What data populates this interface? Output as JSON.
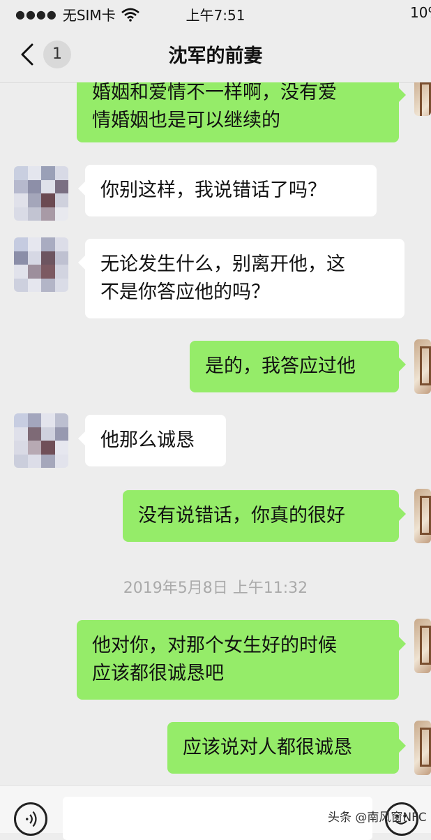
{
  "status_bar": {
    "carrier": "无SIM卡",
    "time": "上午7:51",
    "battery": "10%"
  },
  "nav": {
    "unread_count": "1",
    "title": "沈军的前妻"
  },
  "messages": [
    {
      "dir": "out",
      "lines": [
        "婚姻和爱情不一样啊，没有爱",
        "情婚姻也是可以继续的"
      ]
    },
    {
      "dir": "in",
      "lines": [
        "你别这样，我说错话了吗？"
      ]
    },
    {
      "dir": "in",
      "lines": [
        "无论发生什么，别离开他，这",
        "不是你答应他的吗？"
      ]
    },
    {
      "dir": "out",
      "lines": [
        "是的，我答应过他"
      ]
    },
    {
      "dir": "in",
      "lines": [
        "他那么诚恳"
      ]
    },
    {
      "dir": "out",
      "lines": [
        "没有说错话，你真的很好"
      ]
    },
    {
      "dir": "out",
      "lines": [
        "他对你，对那个女生好的时候",
        "应该都很诚恳吧"
      ]
    },
    {
      "dir": "out",
      "lines": [
        "应该说对人都很诚恳"
      ]
    }
  ],
  "timestamp": "2019年5月8日 上午11:32",
  "input": {
    "placeholder": ""
  },
  "watermark": "头条 @南风窗NFC",
  "colors": {
    "outgoing_bubble": "#95ec69",
    "incoming_bubble": "#ffffff",
    "background": "#ededed"
  },
  "icons": [
    "back-chevron-icon",
    "wifi-icon",
    "voice-icon",
    "emoji-icon"
  ]
}
